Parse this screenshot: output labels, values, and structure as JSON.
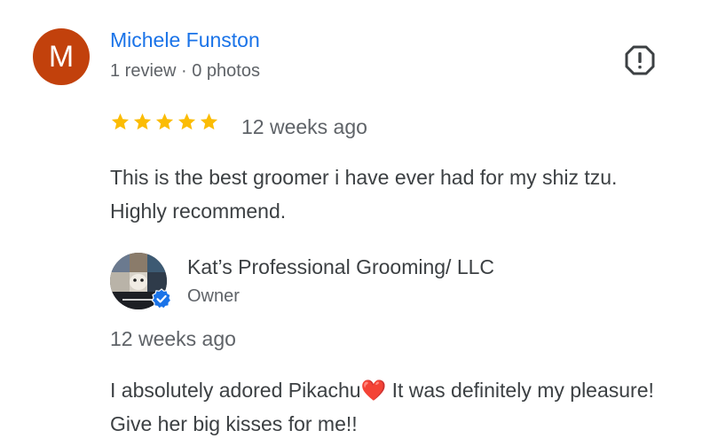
{
  "review": {
    "avatar_letter": "M",
    "avatar_color": "#c2410c",
    "reviewer_name": "Michele Funston",
    "reviewer_meta": "1 review · 0 photos",
    "rating": 5,
    "age": "12 weeks ago",
    "text": "This is the best groomer i have ever had for my shiz tzu. Highly recommend.",
    "report_icon": "report-flag-icon"
  },
  "owner_reply": {
    "name": "Kat’s Professional Grooming/ LLC",
    "role": "Owner",
    "age": "12 weeks ago",
    "text": "I absolutely adored Pikachu❤️ It was definitely my pleasure! Give her big kisses for me!!",
    "verified_icon": "verified-badge-icon"
  },
  "colors": {
    "link": "#1a73e8",
    "star": "#fbbc04",
    "secondary_text": "#5f6368",
    "body_text": "#3c4043"
  }
}
